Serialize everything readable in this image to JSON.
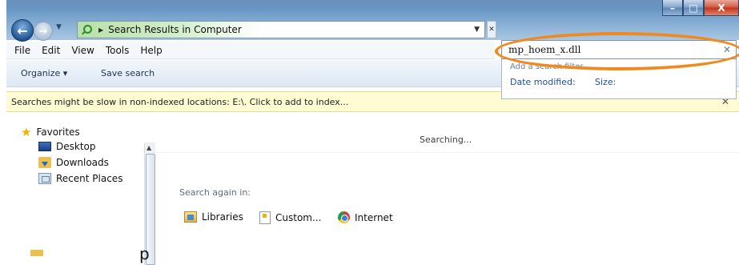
{
  "window": {
    "controls": {
      "minimize": "–",
      "maximize": "□",
      "close": "X"
    }
  },
  "address": {
    "location": "Search Results in Computer"
  },
  "search": {
    "query": "mp_hoem_x.dll",
    "hint": "Add a search filter",
    "filters": [
      "Date modified:",
      "Size:"
    ]
  },
  "menu": {
    "items": [
      "File",
      "Edit",
      "View",
      "Tools",
      "Help"
    ]
  },
  "toolbar": {
    "organize_label": "Organize ▾",
    "save_search_label": "Save search"
  },
  "infobar": {
    "message": "Searches might be slow in non-indexed locations: E:\\. Click to add to index..."
  },
  "nav": {
    "items": [
      "Favorites",
      "Desktop",
      "Downloads",
      "Recent Places"
    ]
  },
  "content": {
    "status": "Searching...",
    "search_again_label": "Search again in:",
    "search_again_items": [
      "Libraries",
      "Custom...",
      "Internet"
    ]
  },
  "stray_text": "p"
}
